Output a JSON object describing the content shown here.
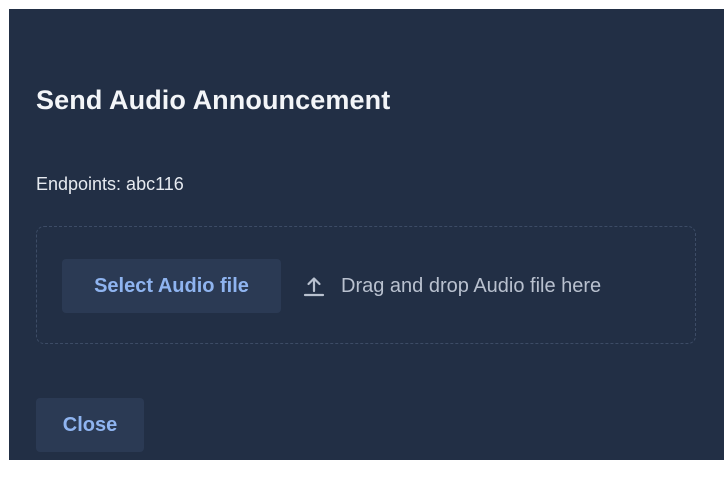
{
  "dialog": {
    "title": "Send Audio Announcement",
    "endpoints_text": "Endpoints: abc116"
  },
  "upload": {
    "select_button_label": "Select Audio file",
    "drop_hint": "Drag and drop Audio file here",
    "icon": "upload-icon"
  },
  "footer": {
    "close_label": "Close"
  },
  "colors": {
    "dialog_background": "#222f45",
    "button_background": "#2b3a54",
    "button_text": "#8fb4f0",
    "title_text": "#f3f5f8",
    "hint_text": "#b9c1cf",
    "dropzone_border": "#3d4c66"
  }
}
